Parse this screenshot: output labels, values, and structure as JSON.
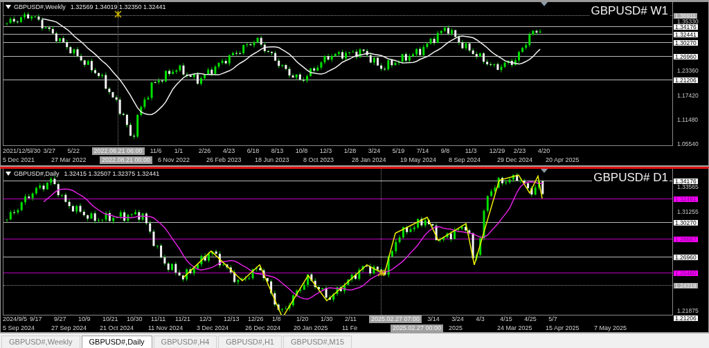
{
  "panes": [
    {
      "title": "GBPUSD#,Weekly",
      "ohlc": "1.32569 1.34019 1.32350 1.32441",
      "label": "GBPUSD# W1",
      "active": false,
      "price_labels": [
        {
          "text": "1.36911",
          "kind": "marker"
        },
        {
          "text": "1.35330",
          "kind": "tick"
        },
        {
          "text": "1.34176",
          "kind": "line"
        },
        {
          "text": "1.32441",
          "kind": "line"
        },
        {
          "text": "1.30270",
          "kind": "line"
        },
        {
          "text": "1.26960",
          "kind": "line"
        },
        {
          "text": "1.23360",
          "kind": "tick"
        },
        {
          "text": "1.21206",
          "kind": "line"
        },
        {
          "text": "1.17420",
          "kind": "tick"
        },
        {
          "text": "1.11480",
          "kind": "tick"
        },
        {
          "text": "1.05540",
          "kind": "tick"
        }
      ],
      "time_rows": [
        [
          {
            "text": "2021/12/5l/30",
            "kind": "date"
          },
          {
            "text": "3/27",
            "kind": "date"
          },
          {
            "text": "5/22",
            "kind": "date"
          },
          {
            "text": "2022.08.21 06:00",
            "kind": "cursor"
          },
          {
            "text": "11/6",
            "kind": "date"
          },
          {
            "text": "1/1",
            "kind": "date"
          },
          {
            "text": "2/26",
            "kind": "date"
          },
          {
            "text": "4/23",
            "kind": "date"
          },
          {
            "text": "6/18",
            "kind": "date"
          },
          {
            "text": "8/13",
            "kind": "date"
          },
          {
            "text": "10/8",
            "kind": "date"
          },
          {
            "text": "12/3",
            "kind": "date"
          },
          {
            "text": "1/28",
            "kind": "date"
          },
          {
            "text": "3/24",
            "kind": "date"
          },
          {
            "text": "5/19",
            "kind": "date"
          },
          {
            "text": "7/14",
            "kind": "date"
          },
          {
            "text": "9/8",
            "kind": "date"
          },
          {
            "text": "11/3",
            "kind": "date"
          },
          {
            "text": "12/29",
            "kind": "date"
          },
          {
            "text": "2/23",
            "kind": "date"
          },
          {
            "text": "4/20",
            "kind": "date"
          }
        ],
        [
          {
            "text": "5 Dec 2021",
            "kind": "date"
          },
          {
            "text": "27 Mar 2022",
            "kind": "date"
          },
          {
            "text": "2022.08.21 00:00",
            "kind": "cursor"
          },
          {
            "text": "6 Nov 2022",
            "kind": "date"
          },
          {
            "text": "26 Feb 2023",
            "kind": "date"
          },
          {
            "text": "18 Jun 2023",
            "kind": "date"
          },
          {
            "text": "8 Oct 2023",
            "kind": "date"
          },
          {
            "text": "28 Jan 2024",
            "kind": "date"
          },
          {
            "text": "19 May 2024",
            "kind": "date"
          },
          {
            "text": "8 Sep 2024",
            "kind": "date"
          },
          {
            "text": "29 Dec 2024",
            "kind": "date"
          },
          {
            "text": "20 Apr 2025",
            "kind": "date"
          }
        ]
      ]
    },
    {
      "title": "GBPUSD#,Daily",
      "ohlc": "1.32415 1.32507 1.32375 1.32441",
      "label": "GBPUSD# D1",
      "active": true,
      "price_labels": [
        {
          "text": "1.34176",
          "kind": "line"
        },
        {
          "text": "1.33565",
          "kind": "tick"
        },
        {
          "text": "1.32491",
          "kind": "level"
        },
        {
          "text": "1.31255",
          "kind": "tick"
        },
        {
          "text": "1.30270",
          "kind": "line"
        },
        {
          "text": "1.28667",
          "kind": "level"
        },
        {
          "text": "1.26960",
          "kind": "line"
        },
        {
          "text": "1.25460",
          "kind": "level"
        },
        {
          "text": "1.24319",
          "kind": "marker"
        },
        {
          "text": "1.21875",
          "kind": "tick"
        },
        {
          "text": "1.21206",
          "kind": "line"
        }
      ],
      "time_rows": [
        [
          {
            "text": "2024/9/5",
            "kind": "date"
          },
          {
            "text": "9/17",
            "kind": "date"
          },
          {
            "text": "9/27",
            "kind": "date"
          },
          {
            "text": "10/9",
            "kind": "date"
          },
          {
            "text": "10/21",
            "kind": "date"
          },
          {
            "text": "10/30",
            "kind": "date"
          },
          {
            "text": "11/11",
            "kind": "date"
          },
          {
            "text": "11/21",
            "kind": "date"
          },
          {
            "text": "12/3",
            "kind": "date"
          },
          {
            "text": "12/13",
            "kind": "date"
          },
          {
            "text": "12/26",
            "kind": "date"
          },
          {
            "text": "1/8",
            "kind": "date"
          },
          {
            "text": "1/20",
            "kind": "date"
          },
          {
            "text": "1/30",
            "kind": "date"
          },
          {
            "text": "2/11",
            "kind": "date"
          },
          {
            "text": "2025.02.27 07:00",
            "kind": "cursor"
          },
          {
            "text": "3/14",
            "kind": "date"
          },
          {
            "text": "3/24",
            "kind": "date"
          },
          {
            "text": "4/3",
            "kind": "date"
          },
          {
            "text": "4/15",
            "kind": "date"
          },
          {
            "text": "4/25",
            "kind": "date"
          },
          {
            "text": "5/7",
            "kind": "date"
          }
        ],
        [
          {
            "text": "5 Sep 2024",
            "kind": "date"
          },
          {
            "text": "27 Sep 2024",
            "kind": "date"
          },
          {
            "text": "21 Oct 2024",
            "kind": "date"
          },
          {
            "text": "11 Nov 2024",
            "kind": "date"
          },
          {
            "text": "3 Dec 2024",
            "kind": "date"
          },
          {
            "text": "26 Dec 2024",
            "kind": "date"
          },
          {
            "text": "20 Jan 2025",
            "kind": "date"
          },
          {
            "text": "11 Fe",
            "kind": "date"
          },
          {
            "text": "2025.02.27 00:00",
            "kind": "cursor"
          },
          {
            "text": "2025",
            "kind": "date"
          },
          {
            "text": "24 Mar 2025",
            "kind": "date"
          },
          {
            "text": "15 Apr 2025",
            "kind": "date"
          },
          {
            "text": "7 May 2025",
            "kind": "date"
          }
        ]
      ]
    }
  ],
  "tabs": [
    {
      "label": "GBPUSD#,Weekly",
      "selected": false
    },
    {
      "label": "GBPUSD#,Daily",
      "selected": true
    },
    {
      "label": "GBPUSD#,H4",
      "selected": false
    },
    {
      "label": "GBPUSD#,H1",
      "selected": false
    },
    {
      "label": "GBPUSD#,M15",
      "selected": false
    }
  ]
}
